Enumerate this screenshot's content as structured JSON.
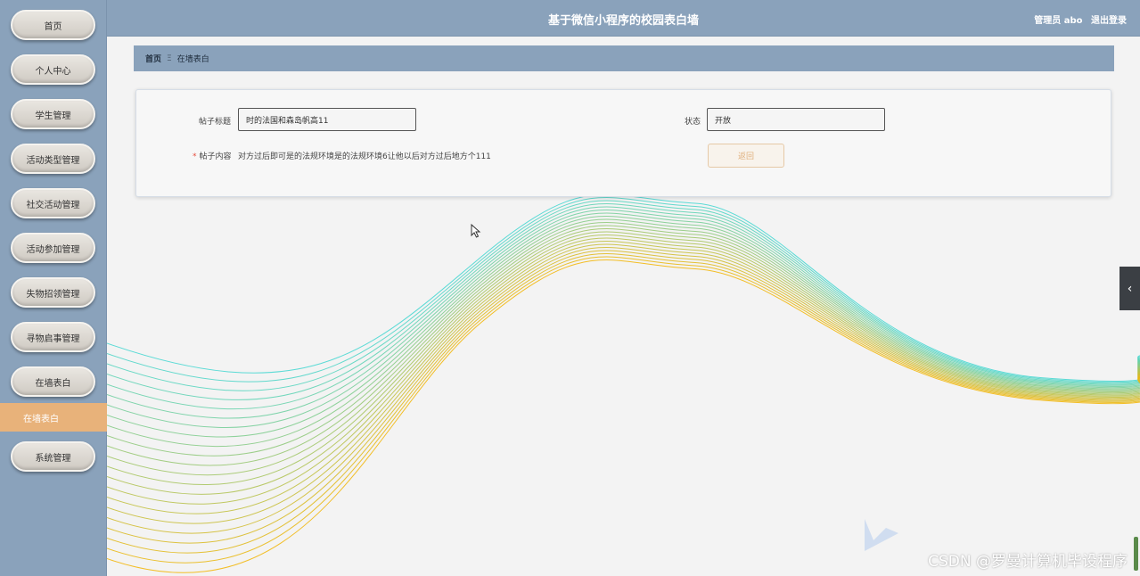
{
  "header": {
    "title": "基于微信小程序的校园表白墙",
    "user_label": "管理员 abo",
    "logout_label": "退出登录"
  },
  "sidebar": {
    "items": [
      {
        "label": "首页"
      },
      {
        "label": "个人中心"
      },
      {
        "label": "学生管理"
      },
      {
        "label": "活动类型管理"
      },
      {
        "label": "社交活动管理"
      },
      {
        "label": "活动参加管理"
      },
      {
        "label": "失物招领管理"
      },
      {
        "label": "寻物启事管理"
      },
      {
        "label": "在墙表白"
      },
      {
        "label": "系统管理"
      }
    ],
    "active_sub": "在墙表白"
  },
  "breadcrumb": {
    "home": "首页",
    "separator": "Ξ",
    "current": "在墙表白"
  },
  "form": {
    "title_label": "帖子标题",
    "title_value": "时的法国和森岛帆高11",
    "status_label": "状态",
    "status_value": "开放",
    "content_required_mark": "*",
    "content_label": "帖子内容",
    "content_value": "对方过后即可是的法规环境是的法规环境6让他以后对方过后地方个111",
    "back_label": "返回"
  },
  "side_toggle_icon": "chevron-left-icon",
  "watermark": "CSDN @罗曼计算机毕设程序",
  "colors": {
    "sidebar_bg": "#8aa2bb",
    "active_sub_bg": "#e8b27a",
    "wave_start": "#3fd6d0",
    "wave_end": "#f2b400"
  }
}
